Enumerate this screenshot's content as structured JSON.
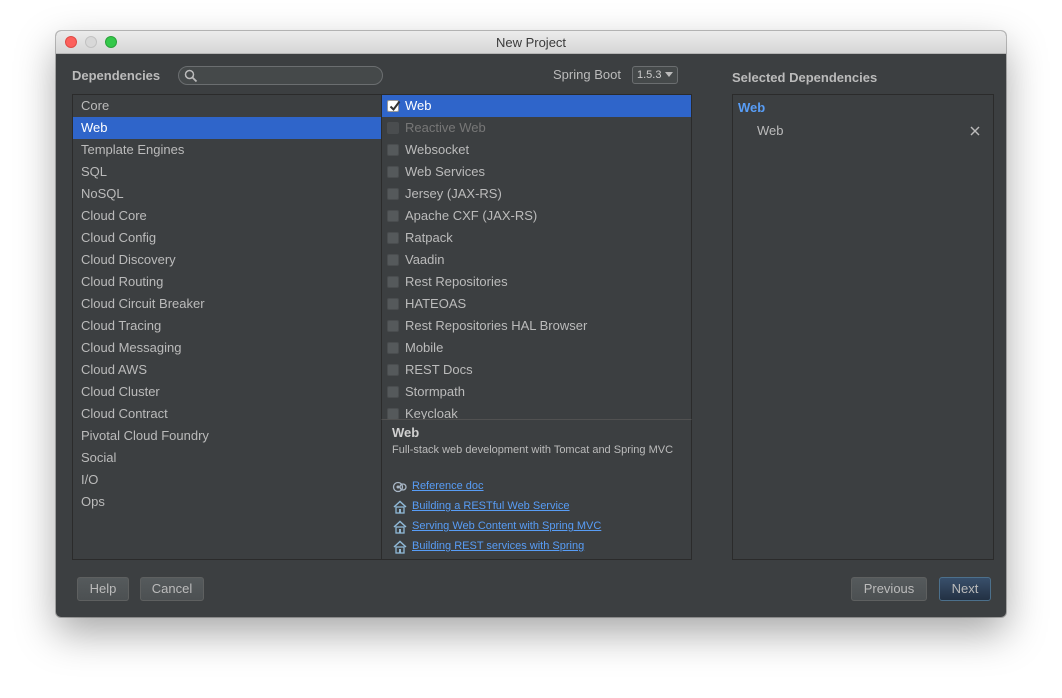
{
  "window": {
    "title": "New Project"
  },
  "header": {
    "dependencies_label": "Dependencies",
    "search_placeholder": "",
    "spring_boot_label": "Spring Boot",
    "spring_boot_version": "1.5.3"
  },
  "categories": [
    "Core",
    "Web",
    "Template Engines",
    "SQL",
    "NoSQL",
    "Cloud Core",
    "Cloud Config",
    "Cloud Discovery",
    "Cloud Routing",
    "Cloud Circuit Breaker",
    "Cloud Tracing",
    "Cloud Messaging",
    "Cloud AWS",
    "Cloud Cluster",
    "Cloud Contract",
    "Pivotal Cloud Foundry",
    "Social",
    "I/O",
    "Ops"
  ],
  "selected_category": "Web",
  "dependencies": [
    {
      "label": "Web",
      "checked": true,
      "enabled": true,
      "selected": true
    },
    {
      "label": "Reactive Web",
      "checked": false,
      "enabled": false,
      "selected": false
    },
    {
      "label": "Websocket",
      "checked": false,
      "enabled": true,
      "selected": false
    },
    {
      "label": "Web Services",
      "checked": false,
      "enabled": true,
      "selected": false
    },
    {
      "label": "Jersey (JAX-RS)",
      "checked": false,
      "enabled": true,
      "selected": false
    },
    {
      "label": "Apache CXF (JAX-RS)",
      "checked": false,
      "enabled": true,
      "selected": false
    },
    {
      "label": "Ratpack",
      "checked": false,
      "enabled": true,
      "selected": false
    },
    {
      "label": "Vaadin",
      "checked": false,
      "enabled": true,
      "selected": false
    },
    {
      "label": "Rest Repositories",
      "checked": false,
      "enabled": true,
      "selected": false
    },
    {
      "label": "HATEOAS",
      "checked": false,
      "enabled": true,
      "selected": false
    },
    {
      "label": "Rest Repositories HAL Browser",
      "checked": false,
      "enabled": true,
      "selected": false
    },
    {
      "label": "Mobile",
      "checked": false,
      "enabled": true,
      "selected": false
    },
    {
      "label": "REST Docs",
      "checked": false,
      "enabled": true,
      "selected": false
    },
    {
      "label": "Stormpath",
      "checked": false,
      "enabled": true,
      "selected": false
    },
    {
      "label": "Keycloak",
      "checked": false,
      "enabled": true,
      "selected": false
    }
  ],
  "description": {
    "title": "Web",
    "text": "Full-stack web development with Tomcat and Spring MVC",
    "links": [
      {
        "label": "Reference doc",
        "icon": "reference-doc-icon"
      },
      {
        "label": "Building a RESTful Web Service",
        "icon": "guide-icon"
      },
      {
        "label": "Serving Web Content with Spring MVC",
        "icon": "guide-icon"
      },
      {
        "label": "Building REST services with Spring",
        "icon": "guide-icon"
      }
    ]
  },
  "selected_dependencies": {
    "label": "Selected Dependencies",
    "groups": [
      {
        "name": "Web",
        "items": [
          "Web"
        ]
      }
    ]
  },
  "buttons": {
    "help": "Help",
    "cancel": "Cancel",
    "previous": "Previous",
    "next": "Next"
  },
  "colors": {
    "background": "#3c3f41",
    "selection": "#2f65ca",
    "link": "#589df6",
    "text": "#bbbbbb"
  }
}
